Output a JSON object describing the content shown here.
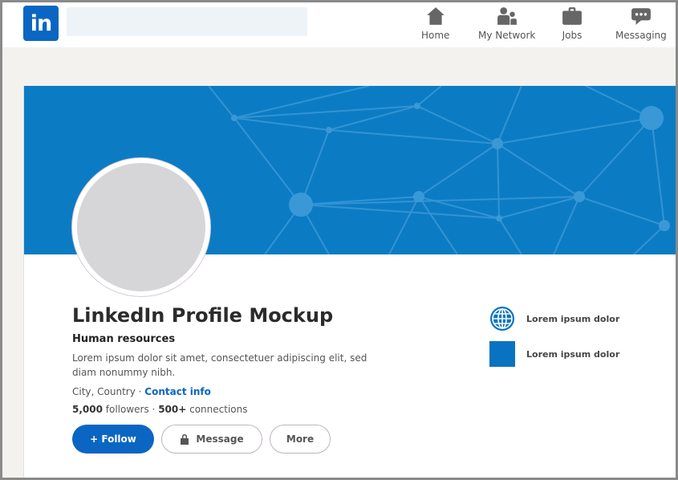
{
  "app": {
    "logo_text": "in"
  },
  "search": {
    "placeholder": ""
  },
  "nav": {
    "items": [
      {
        "label": "Home",
        "icon": "home-icon"
      },
      {
        "label": "My Network",
        "icon": "people-icon"
      },
      {
        "label": "Jobs",
        "icon": "briefcase-icon"
      },
      {
        "label": "Messaging",
        "icon": "chat-icon"
      }
    ]
  },
  "profile": {
    "name": "LinkedIn Profile Mockup",
    "headline": "Human resources",
    "about": "Lorem ipsum dolor sit amet, consectetuer adipiscing elit, sed diam nonummy nibh.",
    "location": "City, Country",
    "separator": " · ",
    "contact_label": "Contact info",
    "followers_count": "5,000",
    "followers_label": " followers · ",
    "connections_count": "500+",
    "connections_label": " connections"
  },
  "actions": {
    "follow": "+ Follow",
    "message": "Message",
    "more": "More"
  },
  "side": {
    "items": [
      {
        "label": "Lorem ipsum dolor",
        "icon": "globe-icon"
      },
      {
        "label": "Lorem ipsum dolor",
        "icon": "square-icon"
      }
    ]
  },
  "colors": {
    "brand": "#0a66c2",
    "banner": "#0b7cc4",
    "background": "#f3f2ef"
  }
}
